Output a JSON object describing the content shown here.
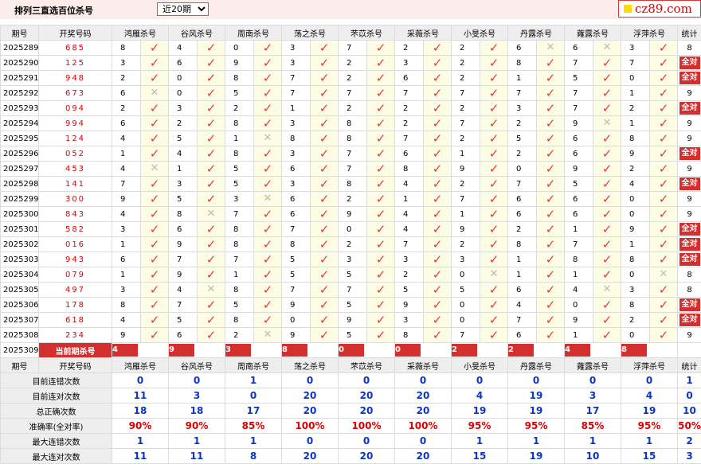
{
  "title": "排列三直选百位杀号",
  "period_select": {
    "selected": "近20期",
    "options": [
      "近20期"
    ]
  },
  "logo": {
    "text": "cz89.com"
  },
  "headers": {
    "issue": "期号",
    "code": "开奖号码",
    "experts": [
      "鸿雁杀号",
      "谷风杀号",
      "周南杀号",
      "荡之杀号",
      "芣苡杀号",
      "采薇杀号",
      "小旻杀号",
      "丹露杀号",
      "蕹露杀号",
      "浮萍杀号"
    ],
    "stat": "统计"
  },
  "rows": [
    {
      "issue": "2025289",
      "code": "685",
      "kills": [
        8,
        4,
        0,
        3,
        7,
        2,
        2,
        6,
        6,
        3
      ],
      "ok": [
        1,
        1,
        1,
        1,
        1,
        1,
        1,
        0,
        0,
        1
      ],
      "stat": "8"
    },
    {
      "issue": "2025290",
      "code": "125",
      "kills": [
        3,
        6,
        9,
        3,
        2,
        3,
        2,
        8,
        7,
        7
      ],
      "ok": [
        1,
        1,
        1,
        1,
        1,
        1,
        1,
        1,
        1,
        1
      ],
      "stat": "全对"
    },
    {
      "issue": "2025291",
      "code": "948",
      "kills": [
        2,
        0,
        8,
        7,
        2,
        6,
        2,
        1,
        5,
        0
      ],
      "ok": [
        1,
        1,
        1,
        1,
        1,
        1,
        1,
        1,
        1,
        1
      ],
      "stat": "全对"
    },
    {
      "issue": "2025292",
      "code": "673",
      "kills": [
        6,
        0,
        5,
        7,
        7,
        7,
        7,
        7,
        7,
        1
      ],
      "ok": [
        0,
        1,
        1,
        1,
        1,
        1,
        1,
        1,
        1,
        1
      ],
      "stat": "9"
    },
    {
      "issue": "2025293",
      "code": "094",
      "kills": [
        2,
        3,
        2,
        1,
        2,
        2,
        2,
        3,
        7,
        2
      ],
      "ok": [
        1,
        1,
        1,
        1,
        1,
        1,
        1,
        1,
        1,
        1
      ],
      "stat": "全对"
    },
    {
      "issue": "2025294",
      "code": "994",
      "kills": [
        6,
        2,
        8,
        3,
        8,
        2,
        7,
        2,
        9,
        1
      ],
      "ok": [
        1,
        1,
        1,
        1,
        1,
        1,
        1,
        1,
        0,
        1
      ],
      "stat": "9"
    },
    {
      "issue": "2025295",
      "code": "124",
      "kills": [
        4,
        5,
        1,
        8,
        8,
        7,
        2,
        5,
        6,
        8
      ],
      "ok": [
        1,
        1,
        0,
        1,
        1,
        1,
        1,
        1,
        1,
        1
      ],
      "stat": "9"
    },
    {
      "issue": "2025296",
      "code": "052",
      "kills": [
        1,
        4,
        8,
        3,
        7,
        6,
        1,
        2,
        6,
        9
      ],
      "ok": [
        1,
        1,
        1,
        1,
        1,
        1,
        1,
        1,
        1,
        1
      ],
      "stat": "全对"
    },
    {
      "issue": "2025297",
      "code": "453",
      "kills": [
        4,
        1,
        5,
        6,
        7,
        8,
        9,
        0,
        9,
        2
      ],
      "ok": [
        0,
        1,
        1,
        1,
        1,
        1,
        1,
        1,
        1,
        1
      ],
      "stat": "9"
    },
    {
      "issue": "2025298",
      "code": "141",
      "kills": [
        7,
        3,
        5,
        3,
        8,
        4,
        2,
        7,
        5,
        4
      ],
      "ok": [
        1,
        1,
        1,
        1,
        1,
        1,
        1,
        1,
        1,
        1
      ],
      "stat": "全对"
    },
    {
      "issue": "2025299",
      "code": "300",
      "kills": [
        9,
        5,
        3,
        6,
        2,
        1,
        7,
        6,
        6,
        0
      ],
      "ok": [
        1,
        1,
        0,
        1,
        1,
        1,
        1,
        1,
        1,
        1
      ],
      "stat": "9"
    },
    {
      "issue": "2025300",
      "code": "843",
      "kills": [
        4,
        8,
        7,
        6,
        9,
        4,
        1,
        6,
        6,
        0
      ],
      "ok": [
        1,
        0,
        1,
        1,
        1,
        1,
        1,
        1,
        1,
        1
      ],
      "stat": "9"
    },
    {
      "issue": "2025301",
      "code": "582",
      "kills": [
        3,
        6,
        8,
        7,
        0,
        4,
        9,
        2,
        1,
        9
      ],
      "ok": [
        1,
        1,
        1,
        1,
        1,
        1,
        1,
        1,
        1,
        1
      ],
      "stat": "全对"
    },
    {
      "issue": "2025302",
      "code": "016",
      "kills": [
        1,
        9,
        8,
        8,
        2,
        7,
        2,
        8,
        7,
        1
      ],
      "ok": [
        1,
        1,
        1,
        1,
        1,
        1,
        1,
        1,
        1,
        1
      ],
      "stat": "全对"
    },
    {
      "issue": "2025303",
      "code": "943",
      "kills": [
        6,
        7,
        7,
        5,
        3,
        3,
        3,
        1,
        8,
        8
      ],
      "ok": [
        1,
        1,
        1,
        1,
        1,
        1,
        1,
        1,
        1,
        1
      ],
      "stat": "全对"
    },
    {
      "issue": "2025304",
      "code": "079",
      "kills": [
        1,
        9,
        1,
        5,
        5,
        2,
        0,
        1,
        1,
        0
      ],
      "ok": [
        1,
        1,
        1,
        1,
        1,
        1,
        0,
        1,
        1,
        0
      ],
      "stat": "8"
    },
    {
      "issue": "2025305",
      "code": "497",
      "kills": [
        3,
        4,
        8,
        7,
        7,
        5,
        5,
        6,
        4,
        3
      ],
      "ok": [
        1,
        0,
        1,
        1,
        1,
        1,
        1,
        1,
        0,
        1
      ],
      "stat": "8"
    },
    {
      "issue": "2025306",
      "code": "178",
      "kills": [
        8,
        7,
        5,
        9,
        5,
        9,
        0,
        4,
        0,
        8
      ],
      "ok": [
        1,
        1,
        1,
        1,
        1,
        1,
        1,
        1,
        1,
        1
      ],
      "stat": "全对"
    },
    {
      "issue": "2025307",
      "code": "618",
      "kills": [
        4,
        5,
        8,
        0,
        9,
        3,
        0,
        7,
        9,
        2
      ],
      "ok": [
        1,
        1,
        1,
        1,
        1,
        1,
        1,
        1,
        1,
        1
      ],
      "stat": "全对"
    },
    {
      "issue": "2025308",
      "code": "234",
      "kills": [
        9,
        6,
        2,
        9,
        5,
        8,
        7,
        6,
        1,
        0
      ],
      "ok": [
        1,
        1,
        0,
        1,
        1,
        1,
        1,
        1,
        1,
        1
      ],
      "stat": "9"
    }
  ],
  "current": {
    "issue": "2025309",
    "label": "当前期杀号",
    "kills": [
      "4",
      "9",
      "3",
      "8",
      "0",
      "0",
      "2",
      "2",
      "4",
      "8"
    ]
  },
  "summary": [
    {
      "label": "目前连错次数",
      "values": [
        "0",
        "0",
        "1",
        "0",
        "0",
        "0",
        "0",
        "0",
        "0",
        "0"
      ],
      "stat": "1"
    },
    {
      "label": "目前连对次数",
      "values": [
        "11",
        "3",
        "0",
        "20",
        "20",
        "20",
        "4",
        "19",
        "3",
        "4"
      ],
      "stat": "0"
    },
    {
      "label": "总正确次数",
      "values": [
        "18",
        "18",
        "17",
        "20",
        "20",
        "20",
        "19",
        "19",
        "17",
        "19"
      ],
      "stat": "10"
    },
    {
      "label": "准确率(全对率)",
      "values": [
        "90%",
        "90%",
        "85%",
        "100%",
        "100%",
        "100%",
        "95%",
        "95%",
        "85%",
        "95%"
      ],
      "stat": "50%",
      "pct": true
    },
    {
      "label": "最大连错次数",
      "values": [
        "1",
        "1",
        "1",
        "0",
        "0",
        "0",
        "1",
        "1",
        "1",
        "1"
      ],
      "stat": "2"
    },
    {
      "label": "最大连对次数",
      "values": [
        "11",
        "11",
        "8",
        "20",
        "20",
        "20",
        "15",
        "19",
        "10",
        "15"
      ],
      "stat": "3"
    }
  ],
  "colors": {
    "accent": "#d32f2f",
    "blue": "#0b34c8",
    "topbar": "#fcecea"
  }
}
